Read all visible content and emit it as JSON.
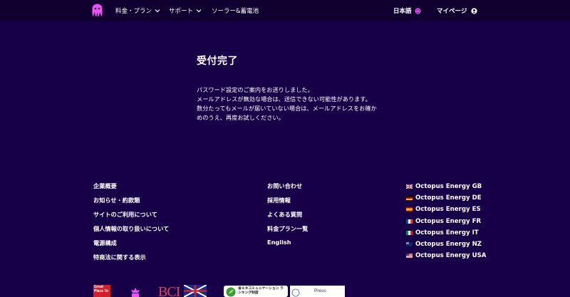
{
  "header": {
    "nav": [
      {
        "label": "料金・プラン"
      },
      {
        "label": "サポート"
      },
      {
        "label": "ソーラー&蓄電池"
      }
    ],
    "language_label": "日本語",
    "mypage_label": "マイページ"
  },
  "main": {
    "title": "受付完了",
    "paragraphs": [
      "パスワード設定のご案内をお送りしました。",
      "メールアドレスが無効な場合は、送信できない可能性があります。",
      "数分たってもメールが届いていない場合は、メールアドレスをお確かめのうえ、再度お試しください。"
    ]
  },
  "footer": {
    "col1": [
      "企業概要",
      "お知らせ・約款類",
      "サイトのご利用について",
      "個人情報の取り扱いについて",
      "電源構成",
      "特商法に関する表示"
    ],
    "col2": [
      "お問い合わせ",
      "採用情報",
      "よくある質問",
      "料金プラン一覧",
      "English"
    ],
    "countries": [
      {
        "label": "Octopus Energy GB",
        "flag": "gb"
      },
      {
        "label": "Octopus Energy DE",
        "flag": "de"
      },
      {
        "label": "Octopus Energy ES",
        "flag": "es"
      },
      {
        "label": "Octopus Energy FR",
        "flag": "fr"
      },
      {
        "label": "Octopus Energy IT",
        "flag": "it"
      },
      {
        "label": "Octopus Energy NZ",
        "flag": "nz"
      },
      {
        "label": "Octopus Energy USA",
        "flag": "us"
      }
    ],
    "badges": {
      "gptw": "Great Place To",
      "bc": "BCI",
      "eco": "省エネコミュニケーション ランキング制度",
      "press": "Press"
    }
  },
  "colors": {
    "background": "#180048",
    "header": "#100030",
    "accent_pink": "#f050f8"
  }
}
